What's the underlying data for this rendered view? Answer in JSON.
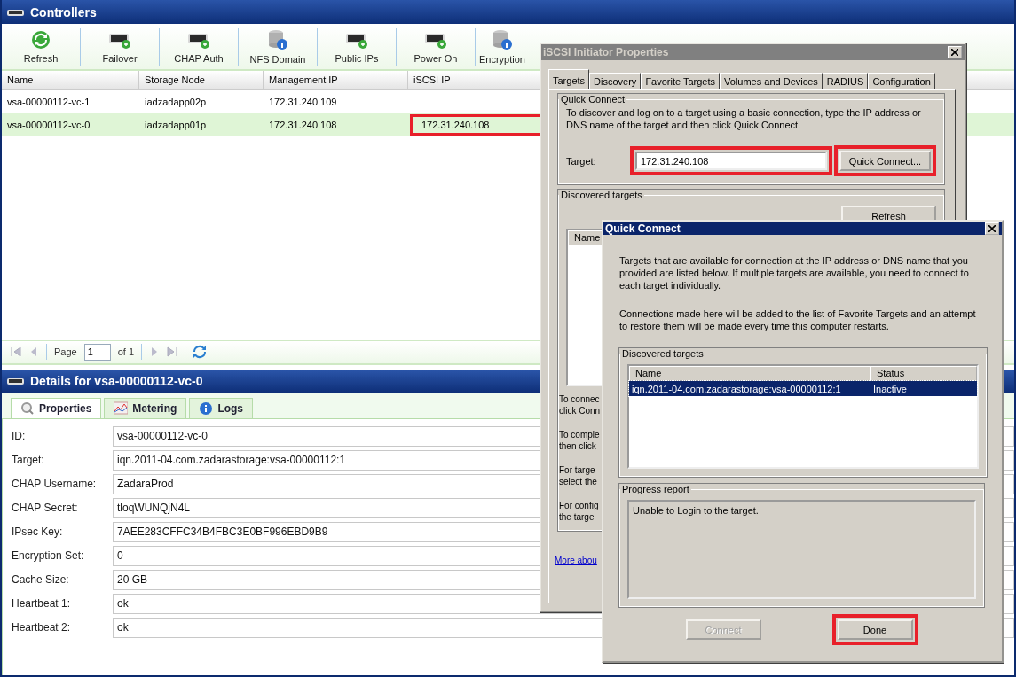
{
  "window": {
    "title": "Controllers"
  },
  "toolbar": [
    {
      "label": "Refresh",
      "kind": "refresh"
    },
    {
      "label": "Failover",
      "kind": "drive"
    },
    {
      "label": "CHAP Auth",
      "kind": "drive"
    },
    {
      "label": "NFS Domain",
      "kind": "database"
    },
    {
      "label": "Public IPs",
      "kind": "drive"
    },
    {
      "label": "Power On",
      "kind": "drive"
    },
    {
      "label": "Encryption",
      "kind": "database"
    }
  ],
  "table": {
    "columns": [
      "Name",
      "Storage Node",
      "Management IP",
      "iSCSI IP"
    ],
    "rows": [
      {
        "name": "vsa-00000112-vc-1",
        "storage_node": "iadzadapp02p",
        "management_ip": "172.31.240.109",
        "selected": false
      },
      {
        "name": "vsa-00000112-vc-0",
        "storage_node": "iadzadapp01p",
        "management_ip": "172.31.240.108",
        "iscsi_ip": "172.31.240.108",
        "iscsi_ip_highlighted": true,
        "selected": true
      }
    ]
  },
  "pager": {
    "page_label": "Page",
    "page": "1",
    "of": "of 1"
  },
  "details": {
    "title": "Details for vsa-00000112-vc-0",
    "tabs": [
      {
        "label": "Properties",
        "kind": "search",
        "selected": true
      },
      {
        "label": "Metering",
        "kind": "chart",
        "selected": false
      },
      {
        "label": "Logs",
        "kind": "info",
        "selected": false
      }
    ],
    "fields": [
      {
        "label": "ID:",
        "value": "vsa-00000112-vc-0"
      },
      {
        "label": "Target:",
        "value": "iqn.2011-04.com.zadarastorage:vsa-00000112:1"
      },
      {
        "label": "CHAP Username:",
        "value": "ZadaraProd"
      },
      {
        "label": "CHAP Secret:",
        "value": "tloqWUNQjN4L"
      },
      {
        "label": "IPsec Key:",
        "value": "7AEE283CFFC34B4FBC3E0BF996EBD9B9"
      },
      {
        "label": "Encryption Set:",
        "value": "0"
      },
      {
        "label": "Cache Size:",
        "value": "20 GB"
      },
      {
        "label": "Heartbeat 1:",
        "value": "ok"
      },
      {
        "label": "Heartbeat 2:",
        "value": "ok"
      }
    ]
  },
  "iscsi_dialog": {
    "title": "iSCSI Initiator Properties",
    "active": false,
    "tabs": [
      {
        "label": "Targets",
        "selected": true
      },
      {
        "label": "Discovery",
        "selected": false
      },
      {
        "label": "Favorite Targets",
        "selected": false
      },
      {
        "label": "Volumes and Devices",
        "selected": false
      },
      {
        "label": "RADIUS",
        "selected": false
      },
      {
        "label": "Configuration",
        "selected": false
      }
    ],
    "quick_connect": {
      "legend": "Quick Connect",
      "description": "To discover and log on to a target using a basic connection, type the IP address or DNS name of the target and then click Quick Connect.",
      "target_label": "Target:",
      "target_value": "172.31.240.108",
      "target_highlighted": true,
      "button": "Quick Connect...",
      "button_highlighted": true
    },
    "discovered": {
      "legend": "Discovered targets",
      "refresh": "Refresh",
      "column": "Name",
      "paragraphs": [
        [
          "To connec",
          "click Conn"
        ],
        [
          "To comple",
          "then click"
        ],
        [
          "For targe",
          "select the"
        ],
        [
          "For config",
          "the targe"
        ]
      ]
    },
    "link": "More abou"
  },
  "quick_connect_dialog": {
    "title": "Quick Connect",
    "active": true,
    "paragraphs": [
      "Targets that are available for connection at the IP address or DNS name that you provided are listed below.  If multiple targets are available, you need to connect to each target individually.",
      "Connections made here will be added to the list of Favorite Targets and an attempt to restore them will be made every time this computer restarts."
    ],
    "discovered": {
      "legend": "Discovered targets",
      "columns": [
        "Name",
        "Status"
      ],
      "rows": [
        {
          "name": "iqn.2011-04.com.zadarastorage:vsa-00000112:1",
          "status": "Inactive",
          "selected": true
        }
      ]
    },
    "progress": {
      "legend": "Progress report",
      "text": "Unable to Login to the target."
    },
    "buttons": [
      {
        "label": "Connect",
        "disabled": true,
        "highlighted": false
      },
      {
        "label": "Done",
        "disabled": false,
        "highlighted": true
      }
    ]
  }
}
